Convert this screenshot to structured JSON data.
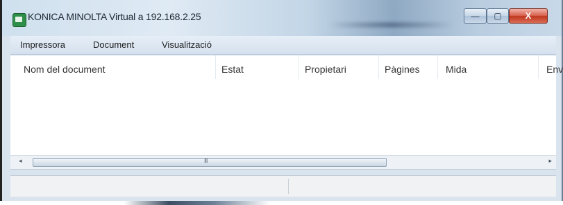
{
  "window": {
    "title": "KONICA MINOLTA Virtual a 192.168.2.25",
    "controls": {
      "minimize_icon": "minimize-icon",
      "maximize_icon": "maximize-icon",
      "close_label": "X"
    }
  },
  "menu": {
    "items": [
      {
        "label": "Impressora"
      },
      {
        "label": "Document"
      },
      {
        "label": "Visualització"
      }
    ]
  },
  "list": {
    "columns": [
      {
        "label": "Nom del document"
      },
      {
        "label": "Estat"
      },
      {
        "label": "Propietari"
      },
      {
        "label": "Pàgines"
      },
      {
        "label": "Mida"
      },
      {
        "label": "Env"
      }
    ],
    "rows": []
  },
  "scrollbar": {
    "left_arrow": "◂",
    "right_arrow": "▸",
    "grip": "III"
  },
  "status": {
    "left": "",
    "right": ""
  },
  "colors": {
    "titlebar": "#cfe0ee",
    "close_button": "#c0371f",
    "menubar": "#dde7f2"
  }
}
